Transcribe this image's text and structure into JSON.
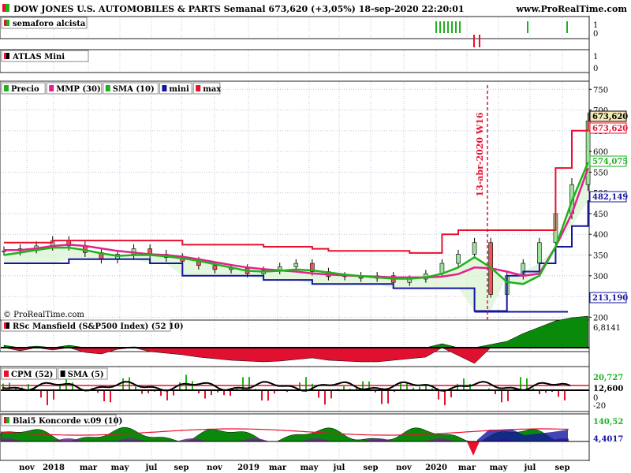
{
  "header": {
    "title": "DOW JONES U.S. AUTOMOBILES & PARTS Semanal 673,620 (+3,05%) 18-sep-2020 22:20:01",
    "site": "www.ProRealTime.com"
  },
  "copyright": "© ProRealTime.com",
  "colors": {
    "green": "#1db21d",
    "red": "#e8102e",
    "blue": "#1414a0",
    "pink": "#e6208a",
    "black": "#000000",
    "fillgreen": "#0a8a0a",
    "fillred": "#e01030",
    "purple": "#6a2a8a",
    "grid": "#b8c8dc"
  },
  "x_axis": {
    "ticks": [
      "nov",
      "2018",
      "mar",
      "may",
      "jul",
      "sep",
      "nov",
      "2019",
      "mar",
      "may",
      "jul",
      "sep",
      "nov",
      "2020",
      "mar",
      "may",
      "jul",
      "sep"
    ]
  },
  "panels": {
    "semaforo": {
      "legend": "semaforo alcista",
      "y_ticks": [
        "1",
        "0"
      ]
    },
    "atlas": {
      "legend": "ATLAS Mini",
      "y_ticks": [
        "1",
        "0"
      ]
    },
    "main": {
      "legend": [
        {
          "label": "Precio",
          "color": "#1db21d"
        },
        {
          "label": "MMP (30)",
          "color": "#e6208a"
        },
        {
          "label": "SMA (10)",
          "color": "#1db21d"
        },
        {
          "label": "mini",
          "color": "#1414a0"
        },
        {
          "label": "max",
          "color": "#e8102e"
        }
      ],
      "y_ticks": [
        "750",
        "700",
        "650",
        "600",
        "550",
        "500",
        "450",
        "400",
        "350",
        "300",
        "250",
        "200"
      ],
      "annotation": "13-abr-2020 W16",
      "badges": [
        {
          "text": "673,620",
          "color": "#000000",
          "bg": "#f5e9b5"
        },
        {
          "text": "673,620",
          "color": "#e8102e",
          "bg": "#ffffff"
        },
        {
          "text": "574,075",
          "color": "#1db21d",
          "bg": "#ffffff"
        },
        {
          "text": "482,149",
          "color": "#1414a0",
          "bg": "#ffffff"
        },
        {
          "text": "213,190",
          "color": "#1414a0",
          "bg": "#ffffff"
        }
      ]
    },
    "rsc": {
      "legend": "RSc Mansfield (S&P500 Index) (52 10)",
      "value": "6,8141"
    },
    "cpm": {
      "legend": [
        {
          "label": "CPM (52)",
          "color": "#e8102e"
        },
        {
          "label": "SMA (5)",
          "color": "#000000"
        }
      ],
      "values": [
        "20,727",
        "12,600"
      ],
      "y_ticks": [
        "0",
        "-20"
      ]
    },
    "koncorde": {
      "legend": "Blai5 Koncorde v.09 (10)",
      "values": [
        "140,52",
        "4,4017"
      ]
    }
  },
  "chart_data": {
    "type": "line",
    "title": "DOW JONES U.S. AUTOMOBILES & PARTS Semanal",
    "frequency": "weekly",
    "ylim": [
      195,
      760
    ],
    "x": [
      "2017-10",
      "2017-11",
      "2017-12",
      "2018-01",
      "2018-02",
      "2018-03",
      "2018-04",
      "2018-05",
      "2018-06",
      "2018-07",
      "2018-08",
      "2018-09",
      "2018-10",
      "2018-11",
      "2018-12",
      "2019-01",
      "2019-02",
      "2019-03",
      "2019-04",
      "2019-05",
      "2019-06",
      "2019-07",
      "2019-08",
      "2019-09",
      "2019-10",
      "2019-11",
      "2019-12",
      "2020-01",
      "2020-02",
      "2020-03",
      "2020-04",
      "2020-05",
      "2020-06",
      "2020-07",
      "2020-08",
      "2020-09"
    ],
    "series": [
      {
        "name": "Precio",
        "values": [
          360,
          365,
          372,
          384,
          372,
          356,
          340,
          352,
          365,
          352,
          344,
          335,
          325,
          315,
          318,
          305,
          313,
          322,
          330,
          310,
          298,
          300,
          294,
          300,
          284,
          292,
          305,
          330,
          352,
          380,
          255,
          300,
          330,
          380,
          450,
          520,
          673.62
        ]
      },
      {
        "name": "MMP (30)",
        "values": [
          362,
          362,
          366,
          372,
          375,
          372,
          366,
          360,
          356,
          352,
          350,
          346,
          340,
          333,
          326,
          320,
          316,
          313,
          310,
          306,
          303,
          301,
          299,
          298,
          296,
          296,
          296,
          298,
          304,
          320,
          318,
          310,
          300,
          305,
          370,
          450,
          560
        ]
      },
      {
        "name": "SMA (10)",
        "values": [
          350,
          356,
          362,
          368,
          368,
          362,
          354,
          348,
          350,
          350,
          347,
          342,
          336,
          328,
          320,
          312,
          310,
          312,
          315,
          313,
          308,
          303,
          299,
          296,
          293,
          293,
          296,
          305,
          320,
          345,
          320,
          285,
          280,
          300,
          370,
          480,
          574.075
        ]
      },
      {
        "name": "mini",
        "values": [
          330,
          330,
          330,
          330,
          340,
          340,
          340,
          340,
          340,
          330,
          330,
          300,
          300,
          300,
          300,
          300,
          290,
          290,
          290,
          280,
          280,
          280,
          280,
          280,
          270,
          270,
          270,
          270,
          270,
          215,
          215,
          300,
          310,
          330,
          370,
          420,
          482.149
        ]
      },
      {
        "name": "max",
        "values": [
          380,
          380,
          380,
          385,
          385,
          385,
          385,
          385,
          385,
          385,
          385,
          375,
          375,
          375,
          375,
          375,
          370,
          370,
          370,
          365,
          360,
          360,
          360,
          360,
          360,
          355,
          355,
          400,
          410,
          410,
          410,
          410,
          410,
          410,
          560,
          650,
          673.62
        ]
      }
    ],
    "annotations": [
      {
        "x": "2020-04-13",
        "label": "13-abr-2020 W16"
      }
    ],
    "last_values": {
      "Precio": 673.62,
      "max": 673.62,
      "SMA (10)": 574.075,
      "mini": 482.149,
      "min_level": 213.19
    }
  }
}
